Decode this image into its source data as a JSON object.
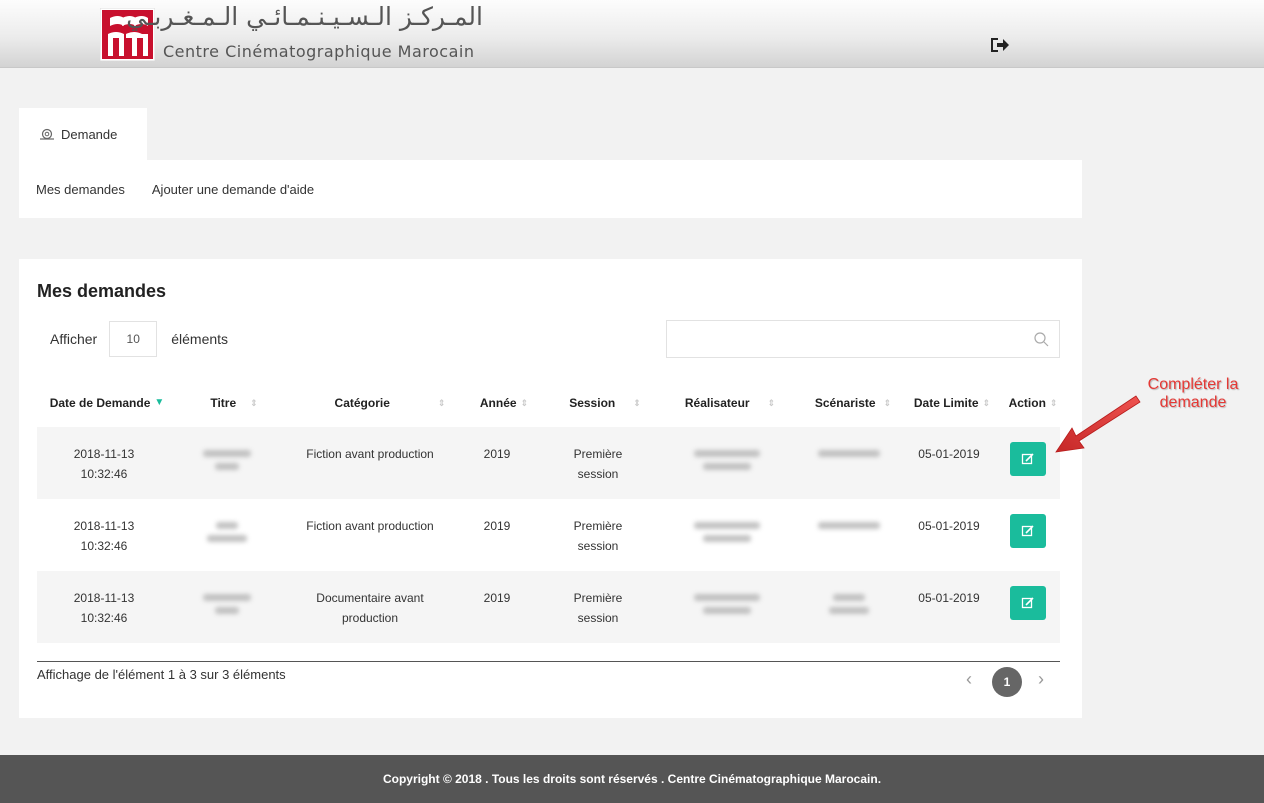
{
  "header": {
    "logo_arabic": "المـركـز الـسـيـنـمـائـي الـمـغـربـي",
    "logo_french": "Centre Cinématographique Marocain",
    "logo_icon": "ccm-logo",
    "logout_icon": "sign-out-icon",
    "brand_red": "#c8102e"
  },
  "tabs": {
    "active_label": "Demande"
  },
  "subnav": {
    "items": [
      "Mes demandes",
      "Ajouter une demande d'aide"
    ]
  },
  "main": {
    "title": "Mes demandes",
    "show_label": "Afficher",
    "show_value": "10",
    "show_suffix": "éléments",
    "search_value": ""
  },
  "table": {
    "columns": [
      "Date de Demande",
      "Titre",
      "Catégorie",
      "Année",
      "Session",
      "Réalisateur",
      "Scénariste",
      "Date Limite",
      "Action"
    ],
    "rows": [
      {
        "date": "2018-11-13",
        "time": "10:32:46",
        "category": "Fiction avant production",
        "year": "2019",
        "session1": "Première",
        "session2": "session",
        "deadline": "05-01-2019"
      },
      {
        "date": "2018-11-13",
        "time": "10:32:46",
        "category": "Fiction avant production",
        "year": "2019",
        "session1": "Première",
        "session2": "session",
        "deadline": "05-01-2019"
      },
      {
        "date": "2018-11-13",
        "time": "10:32:46",
        "category1": "Documentaire avant",
        "category2": "production",
        "year": "2019",
        "session1": "Première",
        "session2": "session",
        "deadline": "05-01-2019"
      }
    ]
  },
  "footer_info": "Affichage de l'élément 1 à 3 sur 3 éléments",
  "pagination": {
    "current": "1",
    "prev": "‹",
    "next": "›"
  },
  "annotation": {
    "line1": "Compléter la",
    "line2": "demande",
    "color": "#e53935"
  },
  "footer": {
    "copyright": "Copyright © 2018 . Tous les droits sont réservés . Centre Cinématographique Marocain."
  },
  "colors": {
    "accent": "#1abc9c",
    "footer_bg": "#555555"
  }
}
